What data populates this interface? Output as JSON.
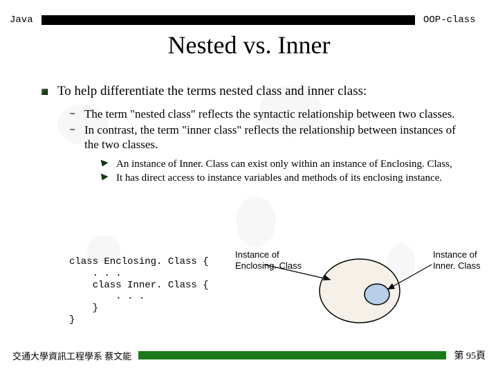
{
  "header": {
    "left": "Java",
    "right": "OOP-class"
  },
  "title": "Nested vs. Inner",
  "main_bullet": "To help differentiate the terms nested class and inner class:",
  "sub_bullets": [
    "The term \"nested class\" reflects the syntactic relationship between two classes.",
    "In contrast, the term \"inner class\" reflects the relationship between instances of the two classes."
  ],
  "subsub_bullets": [
    "An instance of Inner. Class can exist only within an instance of Enclosing. Class,",
    "It has direct access to instance variables and methods of its enclosing instance."
  ],
  "code": "class Enclosing. Class {\n    . . .\n    class Inner. Class {\n        . . .\n    }\n}",
  "diagram": {
    "outer_label_l1": "Instance of",
    "outer_label_l2": "Enclosing. Class",
    "inner_label_l1": "Instance of",
    "inner_label_l2": "Inner. Class"
  },
  "footer": {
    "left": "交通大學資訊工程學系 蔡文能",
    "right": "第 95頁"
  }
}
